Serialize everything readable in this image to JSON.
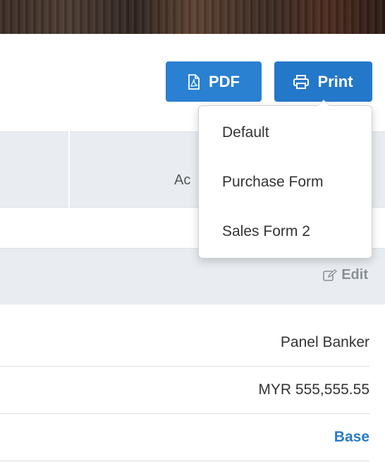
{
  "toolbar": {
    "pdf_label": "PDF",
    "print_label": "Print",
    "accent_color": "#2a80d1"
  },
  "print_menu": {
    "items": [
      {
        "label": "Default"
      },
      {
        "label": "Purchase Form"
      },
      {
        "label": "Sales Form 2"
      }
    ]
  },
  "table": {
    "header_partial": "Ac"
  },
  "section": {
    "edit_label": "Edit"
  },
  "details": {
    "rows": [
      {
        "value": "Panel Banker"
      },
      {
        "value": "MYR 555,555.55"
      },
      {
        "value": "Base"
      }
    ]
  },
  "icons": {
    "pdf": "pdf-file-icon",
    "print": "printer-icon",
    "edit": "edit-pencil-icon"
  }
}
